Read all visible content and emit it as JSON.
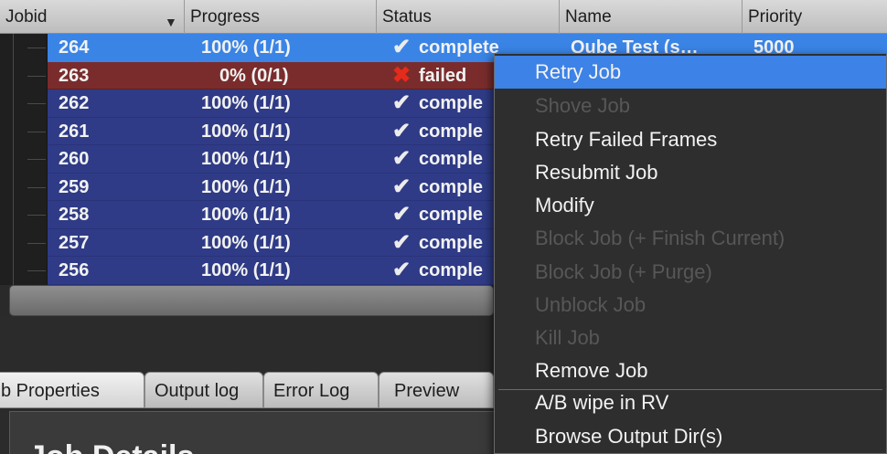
{
  "colors": {
    "row_selected": "#2f3b86",
    "row_failed": "#7a2c2c",
    "row_active": "#3a84e6",
    "menu_highlight": "#3d82e6",
    "failed_icon": "#e32c1b"
  },
  "table": {
    "columns": {
      "jobid": "Jobid",
      "progress": "Progress",
      "status": "Status",
      "name": "Name",
      "priority": "Priority"
    },
    "sort_icon": "sort-descending-icon",
    "rows": [
      {
        "jobid": "264",
        "progress": "100% (1/1)",
        "status": "complete",
        "status_icon": "check-icon",
        "name": "Qube Test (s…",
        "priority": "5000"
      },
      {
        "jobid": "263",
        "progress": "0% (0/1)",
        "status": "failed",
        "status_icon": "cross-icon",
        "name": "",
        "priority": ""
      },
      {
        "jobid": "262",
        "progress": "100% (1/1)",
        "status": "comple",
        "status_icon": "check-icon",
        "name": "",
        "priority": ""
      },
      {
        "jobid": "261",
        "progress": "100% (1/1)",
        "status": "comple",
        "status_icon": "check-icon",
        "name": "",
        "priority": ""
      },
      {
        "jobid": "260",
        "progress": "100% (1/1)",
        "status": "comple",
        "status_icon": "check-icon",
        "name": "",
        "priority": ""
      },
      {
        "jobid": "259",
        "progress": "100% (1/1)",
        "status": "comple",
        "status_icon": "check-icon",
        "name": "",
        "priority": ""
      },
      {
        "jobid": "258",
        "progress": "100% (1/1)",
        "status": "comple",
        "status_icon": "check-icon",
        "name": "",
        "priority": ""
      },
      {
        "jobid": "257",
        "progress": "100% (1/1)",
        "status": "comple",
        "status_icon": "check-icon",
        "name": "",
        "priority": ""
      },
      {
        "jobid": "256",
        "progress": "100% (1/1)",
        "status": "comple",
        "status_icon": "check-icon",
        "name": "",
        "priority": ""
      }
    ]
  },
  "tabs": {
    "job_properties": "b Properties",
    "output_log": "Output log",
    "error_log": "Error Log",
    "preview": "Preview"
  },
  "details": {
    "title": "Job Details"
  },
  "context_menu": {
    "items": [
      {
        "label": "Retry Job",
        "enabled": true,
        "highlighted": true
      },
      {
        "label": "Shove Job",
        "enabled": false
      },
      {
        "label": "Retry Failed Frames",
        "enabled": true
      },
      {
        "label": "Resubmit Job",
        "enabled": true
      },
      {
        "label": "Modify",
        "enabled": true
      },
      {
        "label": "Block Job (+ Finish Current)",
        "enabled": false
      },
      {
        "label": "Block Job (+ Purge)",
        "enabled": false
      },
      {
        "label": "Unblock Job",
        "enabled": false
      },
      {
        "label": "Kill Job",
        "enabled": false
      },
      {
        "label": "Remove Job",
        "enabled": true
      },
      {
        "label": "A/B wipe in RV",
        "enabled": true
      },
      {
        "label": "Browse Output Dir(s)",
        "enabled": true
      }
    ]
  }
}
